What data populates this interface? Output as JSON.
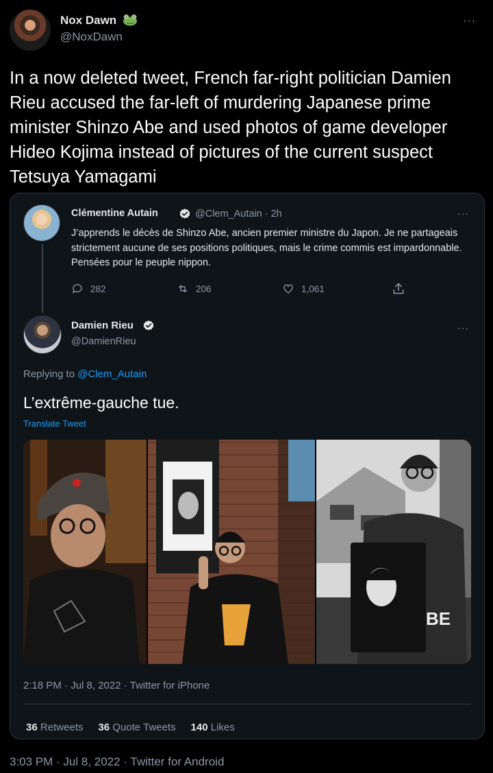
{
  "tweet": {
    "author_name": "Nox Dawn",
    "author_handle": "@NoxDawn",
    "more": "···",
    "text": "In a now deleted tweet, French far-right politician Damien Rieu accused the far-left of murdering Japanese prime minister Shinzo Abe and used photos of game developer Hideo Kojima instead of pictures of the current suspect Tetsuya Yamagami",
    "timestamp": "3:03 PM · Jul 8, 2022 · Twitter for Android"
  },
  "quoted": {
    "parent": {
      "author_name": "Clémentine Autain",
      "author_handle": "@Clem_Autain · 2h",
      "more": "···",
      "text": "J’apprends le décès de Shinzo Abe, ancien premier ministre du Japon. Je ne partageais strictement aucune de ses positions politiques, mais le crime commis est impardonnable. Pensées pour le peuple nippon.",
      "replies": "282",
      "retweets": "206",
      "likes": "1,061"
    },
    "reply": {
      "author_name": "Damien Rieu",
      "author_handle": "@DamienRieu",
      "more": "···",
      "replying_prefix": "Replying to ",
      "replying_mention": "@Clem_Autain",
      "text": "L’extrême-gauche tue.",
      "translate": "Translate Tweet",
      "timestamp": "2:18 PM · Jul 8, 2022 · Twitter for iPhone",
      "retweets_count": "36",
      "retweets_label": "Retweets",
      "quotes_count": "36",
      "quotes_label": "Quote Tweets",
      "likes_count": "140",
      "likes_label": "Likes"
    }
  },
  "colors": {
    "background": "#000000",
    "card": "#0f1419",
    "text_secondary": "#8b98a5",
    "link": "#1d9bf0",
    "verified": "#e7e9ea"
  }
}
